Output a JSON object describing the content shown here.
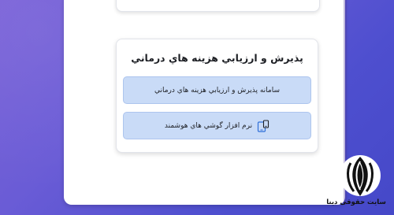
{
  "section": {
    "title": "پذيرش و ارزيابي هزينه هاي درماني",
    "buttons": [
      {
        "label": "سامانه پذيرش و ارزيابي هزينه هاي درماني",
        "icon": ""
      },
      {
        "label": "نرم افزار گوشي هاي هوشمند",
        "icon": "smartphone-tablet-icon"
      }
    ]
  },
  "watermark": {
    "text": "سایت حقوقی دینا"
  },
  "colors": {
    "background": "#5a54d2",
    "button_fill": "#c9dbf7",
    "button_border": "#adc5ee",
    "icon_accent": "#2f6fd8"
  }
}
